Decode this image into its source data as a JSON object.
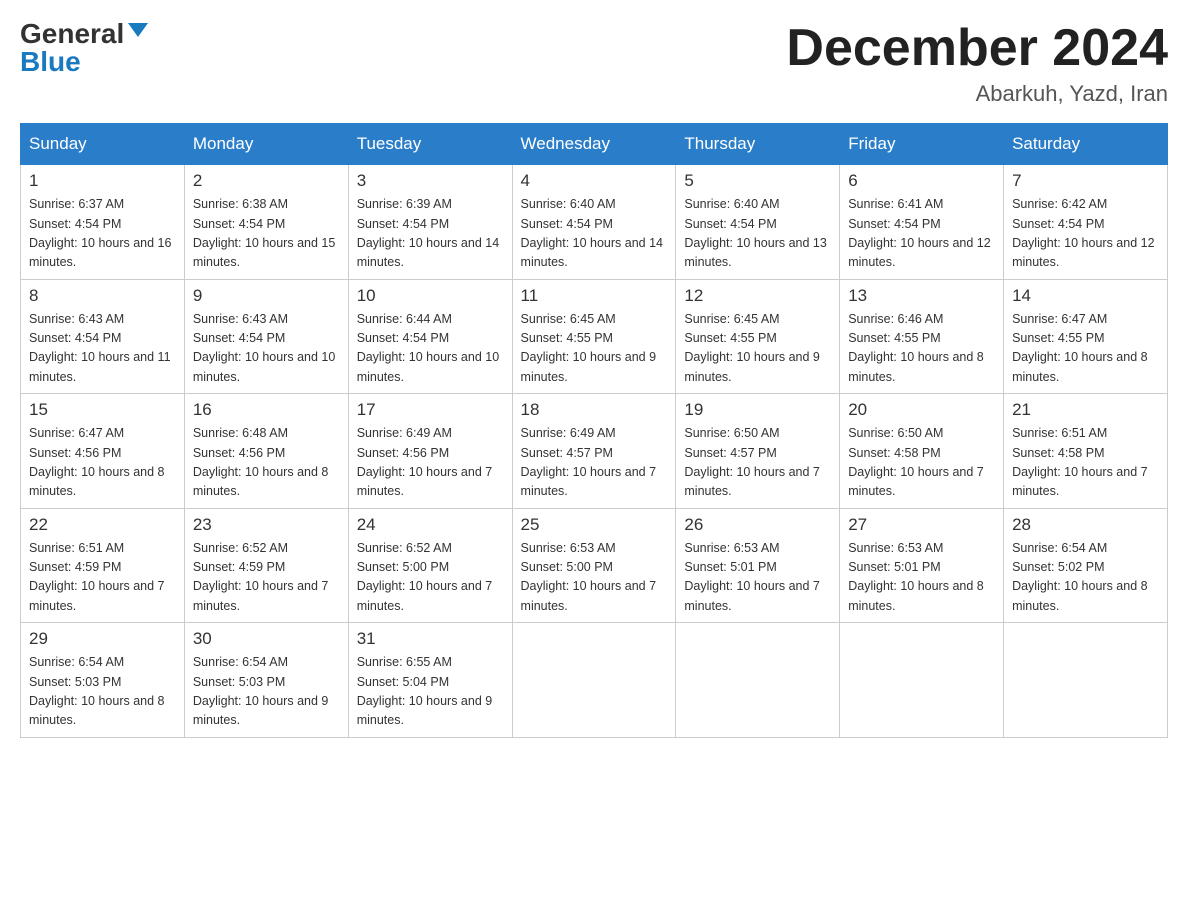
{
  "logo": {
    "general": "General",
    "blue": "Blue"
  },
  "header": {
    "month": "December 2024",
    "location": "Abarkuh, Yazd, Iran"
  },
  "days_of_week": [
    "Sunday",
    "Monday",
    "Tuesday",
    "Wednesday",
    "Thursday",
    "Friday",
    "Saturday"
  ],
  "weeks": [
    [
      {
        "num": "1",
        "sunrise": "6:37 AM",
        "sunset": "4:54 PM",
        "daylight": "10 hours and 16 minutes."
      },
      {
        "num": "2",
        "sunrise": "6:38 AM",
        "sunset": "4:54 PM",
        "daylight": "10 hours and 15 minutes."
      },
      {
        "num": "3",
        "sunrise": "6:39 AM",
        "sunset": "4:54 PM",
        "daylight": "10 hours and 14 minutes."
      },
      {
        "num": "4",
        "sunrise": "6:40 AM",
        "sunset": "4:54 PM",
        "daylight": "10 hours and 14 minutes."
      },
      {
        "num": "5",
        "sunrise": "6:40 AM",
        "sunset": "4:54 PM",
        "daylight": "10 hours and 13 minutes."
      },
      {
        "num": "6",
        "sunrise": "6:41 AM",
        "sunset": "4:54 PM",
        "daylight": "10 hours and 12 minutes."
      },
      {
        "num": "7",
        "sunrise": "6:42 AM",
        "sunset": "4:54 PM",
        "daylight": "10 hours and 12 minutes."
      }
    ],
    [
      {
        "num": "8",
        "sunrise": "6:43 AM",
        "sunset": "4:54 PM",
        "daylight": "10 hours and 11 minutes."
      },
      {
        "num": "9",
        "sunrise": "6:43 AM",
        "sunset": "4:54 PM",
        "daylight": "10 hours and 10 minutes."
      },
      {
        "num": "10",
        "sunrise": "6:44 AM",
        "sunset": "4:54 PM",
        "daylight": "10 hours and 10 minutes."
      },
      {
        "num": "11",
        "sunrise": "6:45 AM",
        "sunset": "4:55 PM",
        "daylight": "10 hours and 9 minutes."
      },
      {
        "num": "12",
        "sunrise": "6:45 AM",
        "sunset": "4:55 PM",
        "daylight": "10 hours and 9 minutes."
      },
      {
        "num": "13",
        "sunrise": "6:46 AM",
        "sunset": "4:55 PM",
        "daylight": "10 hours and 8 minutes."
      },
      {
        "num": "14",
        "sunrise": "6:47 AM",
        "sunset": "4:55 PM",
        "daylight": "10 hours and 8 minutes."
      }
    ],
    [
      {
        "num": "15",
        "sunrise": "6:47 AM",
        "sunset": "4:56 PM",
        "daylight": "10 hours and 8 minutes."
      },
      {
        "num": "16",
        "sunrise": "6:48 AM",
        "sunset": "4:56 PM",
        "daylight": "10 hours and 8 minutes."
      },
      {
        "num": "17",
        "sunrise": "6:49 AM",
        "sunset": "4:56 PM",
        "daylight": "10 hours and 7 minutes."
      },
      {
        "num": "18",
        "sunrise": "6:49 AM",
        "sunset": "4:57 PM",
        "daylight": "10 hours and 7 minutes."
      },
      {
        "num": "19",
        "sunrise": "6:50 AM",
        "sunset": "4:57 PM",
        "daylight": "10 hours and 7 minutes."
      },
      {
        "num": "20",
        "sunrise": "6:50 AM",
        "sunset": "4:58 PM",
        "daylight": "10 hours and 7 minutes."
      },
      {
        "num": "21",
        "sunrise": "6:51 AM",
        "sunset": "4:58 PM",
        "daylight": "10 hours and 7 minutes."
      }
    ],
    [
      {
        "num": "22",
        "sunrise": "6:51 AM",
        "sunset": "4:59 PM",
        "daylight": "10 hours and 7 minutes."
      },
      {
        "num": "23",
        "sunrise": "6:52 AM",
        "sunset": "4:59 PM",
        "daylight": "10 hours and 7 minutes."
      },
      {
        "num": "24",
        "sunrise": "6:52 AM",
        "sunset": "5:00 PM",
        "daylight": "10 hours and 7 minutes."
      },
      {
        "num": "25",
        "sunrise": "6:53 AM",
        "sunset": "5:00 PM",
        "daylight": "10 hours and 7 minutes."
      },
      {
        "num": "26",
        "sunrise": "6:53 AM",
        "sunset": "5:01 PM",
        "daylight": "10 hours and 7 minutes."
      },
      {
        "num": "27",
        "sunrise": "6:53 AM",
        "sunset": "5:01 PM",
        "daylight": "10 hours and 8 minutes."
      },
      {
        "num": "28",
        "sunrise": "6:54 AM",
        "sunset": "5:02 PM",
        "daylight": "10 hours and 8 minutes."
      }
    ],
    [
      {
        "num": "29",
        "sunrise": "6:54 AM",
        "sunset": "5:03 PM",
        "daylight": "10 hours and 8 minutes."
      },
      {
        "num": "30",
        "sunrise": "6:54 AM",
        "sunset": "5:03 PM",
        "daylight": "10 hours and 9 minutes."
      },
      {
        "num": "31",
        "sunrise": "6:55 AM",
        "sunset": "5:04 PM",
        "daylight": "10 hours and 9 minutes."
      },
      null,
      null,
      null,
      null
    ]
  ]
}
